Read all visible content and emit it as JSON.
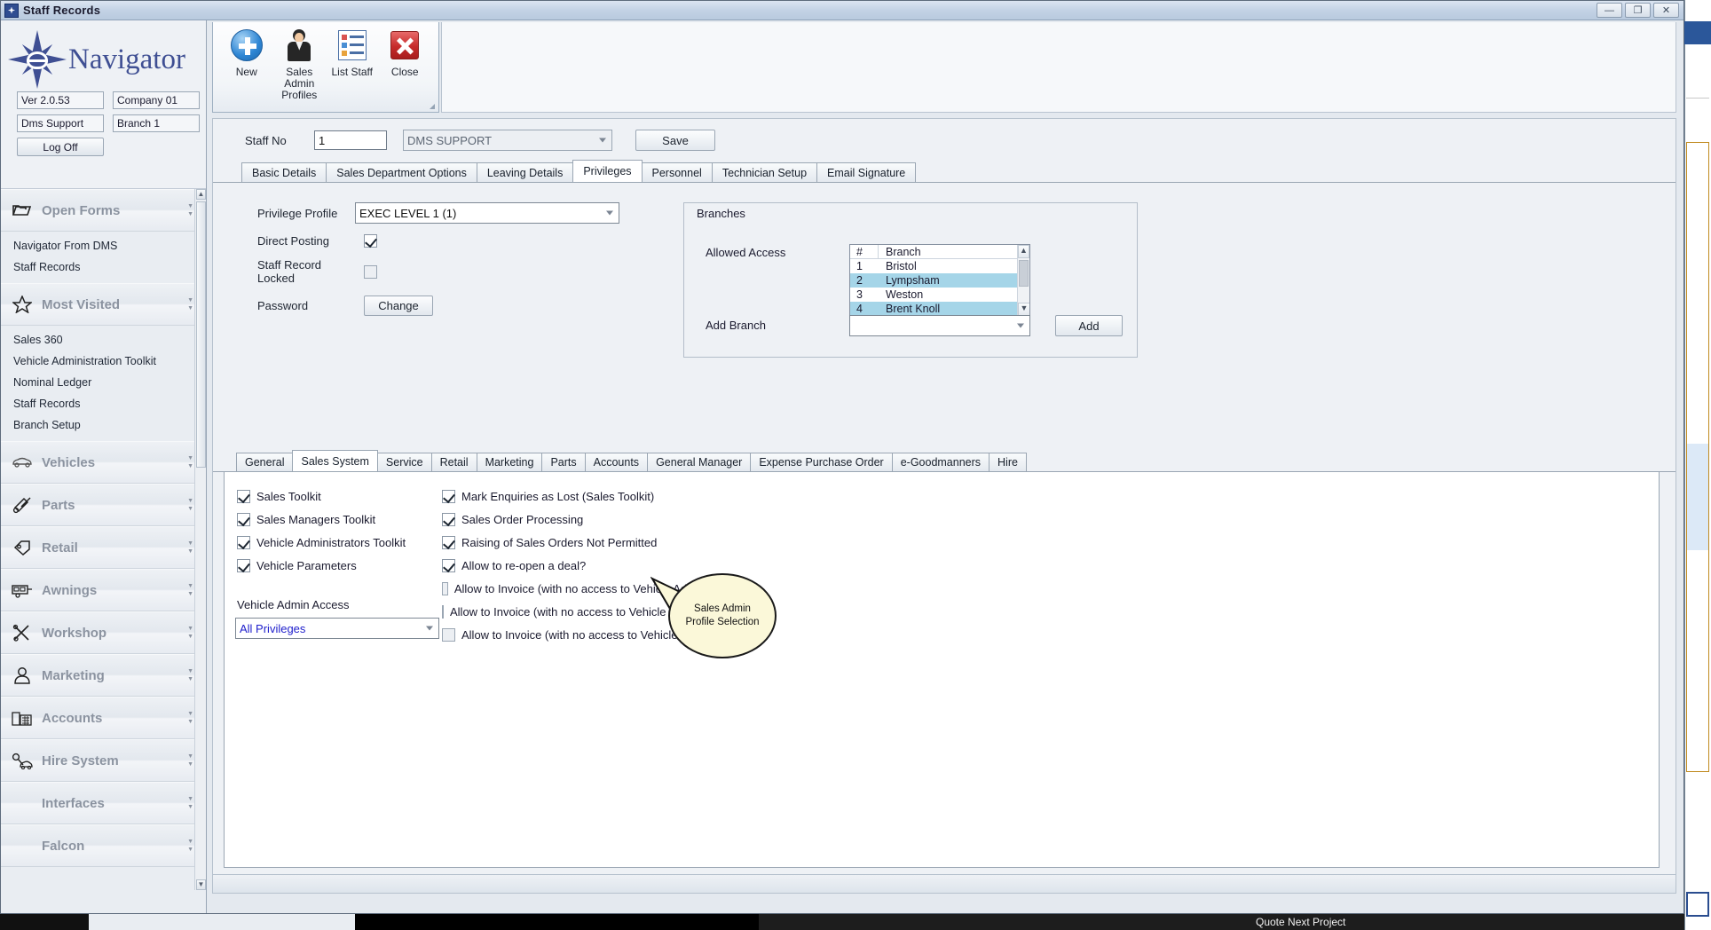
{
  "window": {
    "title": "Staff Records",
    "icon": "app-compass-icon",
    "buttons": {
      "minimize": "—",
      "restore": "❐",
      "close": "✕"
    }
  },
  "navigator": {
    "logo_text": "Navigator",
    "fields": [
      {
        "name": "version",
        "value": "Ver 2.0.53"
      },
      {
        "name": "company",
        "value": "Company 01"
      },
      {
        "name": "user",
        "value": "Dms Support"
      },
      {
        "name": "branch",
        "value": "Branch 1"
      }
    ],
    "logoff_label": "Log Off",
    "groups": [
      {
        "label": "Open Forms",
        "icon": "folder-icon",
        "chevron": "»",
        "items": [
          "Navigator From DMS",
          "Staff Records"
        ]
      },
      {
        "label": "Most Visited",
        "icon": "star-icon",
        "chevron": "»",
        "items": [
          "Sales 360",
          "Vehicle Administration Toolkit",
          "Nominal Ledger",
          "Staff Records",
          "Branch Setup"
        ]
      },
      {
        "label": "Vehicles",
        "icon": "car-icon",
        "chevron": "»",
        "items": []
      },
      {
        "label": "Parts",
        "icon": "spanner-icon",
        "chevron": "»",
        "items": []
      },
      {
        "label": "Retail",
        "icon": "tag-icon",
        "chevron": "»",
        "items": []
      },
      {
        "label": "Awnings",
        "icon": "caravan-icon",
        "chevron": "»",
        "items": []
      },
      {
        "label": "Workshop",
        "icon": "tools-icon",
        "chevron": "»",
        "items": []
      },
      {
        "label": "Marketing",
        "icon": "person-icon",
        "chevron": "»",
        "items": []
      },
      {
        "label": "Accounts",
        "icon": "ledger-icon",
        "chevron": "»",
        "items": []
      },
      {
        "label": "Hire System",
        "icon": "key-car-icon",
        "chevron": "»",
        "items": []
      },
      {
        "label": "Interfaces",
        "icon": "",
        "chevron": "»",
        "items": []
      },
      {
        "label": "Falcon",
        "icon": "",
        "chevron": "»",
        "items": []
      }
    ]
  },
  "ribbon": {
    "buttons": [
      {
        "label": "New",
        "icon": "plus-circle-icon"
      },
      {
        "label": "Sales Admin Profiles",
        "icon": "person-icon"
      },
      {
        "label": "List Staff",
        "icon": "list-icon"
      },
      {
        "label": "Close",
        "icon": "close-x-icon"
      }
    ]
  },
  "form": {
    "staff_no_label": "Staff No",
    "staff_no_value": "1",
    "staff_name_value": "DMS SUPPORT",
    "save_label": "Save",
    "tabs": [
      {
        "label": "Basic Details",
        "selected": false
      },
      {
        "label": "Sales Department Options",
        "selected": false
      },
      {
        "label": "Leaving Details",
        "selected": false
      },
      {
        "label": "Privileges",
        "selected": true
      },
      {
        "label": "Personnel",
        "selected": false
      },
      {
        "label": "Technician Setup",
        "selected": false
      },
      {
        "label": "Email Signature",
        "selected": false
      }
    ]
  },
  "privileges": {
    "profile_label": "Privilege Profile",
    "profile_value": "EXEC LEVEL 1 (1)",
    "direct_posting_label": "Direct Posting",
    "direct_posting_checked": true,
    "staff_record_locked_label": "Staff Record Locked",
    "staff_record_locked_checked": false,
    "password_label": "Password",
    "change_label": "Change"
  },
  "branches": {
    "legend": "Branches",
    "allowed_access_label": "Allowed Access",
    "columns": [
      "#",
      "Branch"
    ],
    "rows": [
      {
        "num": "1",
        "branch": "Bristol",
        "selected": false
      },
      {
        "num": "2",
        "branch": "Lympsham",
        "selected": true
      },
      {
        "num": "3",
        "branch": "Weston",
        "selected": false
      },
      {
        "num": "4",
        "branch": "Brent Knoll",
        "selected": true
      }
    ],
    "add_branch_label": "Add Branch",
    "add_branch_value": "",
    "add_button_label": "Add"
  },
  "sub_tabs": [
    {
      "label": "General",
      "selected": false
    },
    {
      "label": "Sales System",
      "selected": true
    },
    {
      "label": "Service",
      "selected": false
    },
    {
      "label": "Retail",
      "selected": false
    },
    {
      "label": "Marketing",
      "selected": false
    },
    {
      "label": "Parts",
      "selected": false
    },
    {
      "label": "Accounts",
      "selected": false
    },
    {
      "label": "General Manager",
      "selected": false
    },
    {
      "label": "Expense Purchase Order",
      "selected": false
    },
    {
      "label": "e-Goodmanners",
      "selected": false
    },
    {
      "label": "Hire",
      "selected": false
    }
  ],
  "sales_system": {
    "left_checks": [
      {
        "label": "Sales Toolkit",
        "checked": true
      },
      {
        "label": "Sales Managers Toolkit",
        "checked": true
      },
      {
        "label": "Vehicle Administrators Toolkit",
        "checked": true
      },
      {
        "label": "Vehicle Parameters",
        "checked": true
      }
    ],
    "right_checks": [
      {
        "label": "Mark Enquiries as Lost (Sales Toolkit)",
        "checked": true
      },
      {
        "label": "Sales Order Processing",
        "checked": true
      },
      {
        "label": "Raising of Sales Orders Not Permitted",
        "checked": true
      },
      {
        "label": "Allow to re-open a deal?",
        "checked": true
      },
      {
        "label": "Allow to Invoice (with no access to Vehicle Admini",
        "checked": false
      },
      {
        "label": "Allow to Invoice (with no access to Vehicle Adminis",
        "checked": false
      },
      {
        "label": "Allow to Invoice (with no access to Vehicle Adn",
        "checked": false
      }
    ],
    "vehicle_admin_access_label": "Vehicle Admin Access",
    "vehicle_admin_access_value": "All Privileges"
  },
  "callout": {
    "line1": "Sales Admin",
    "line2": "Profile Selection"
  },
  "colors": {
    "accent": "#3f4f93",
    "selection": "#a5d5e8",
    "combo_text": "#2020cc"
  }
}
